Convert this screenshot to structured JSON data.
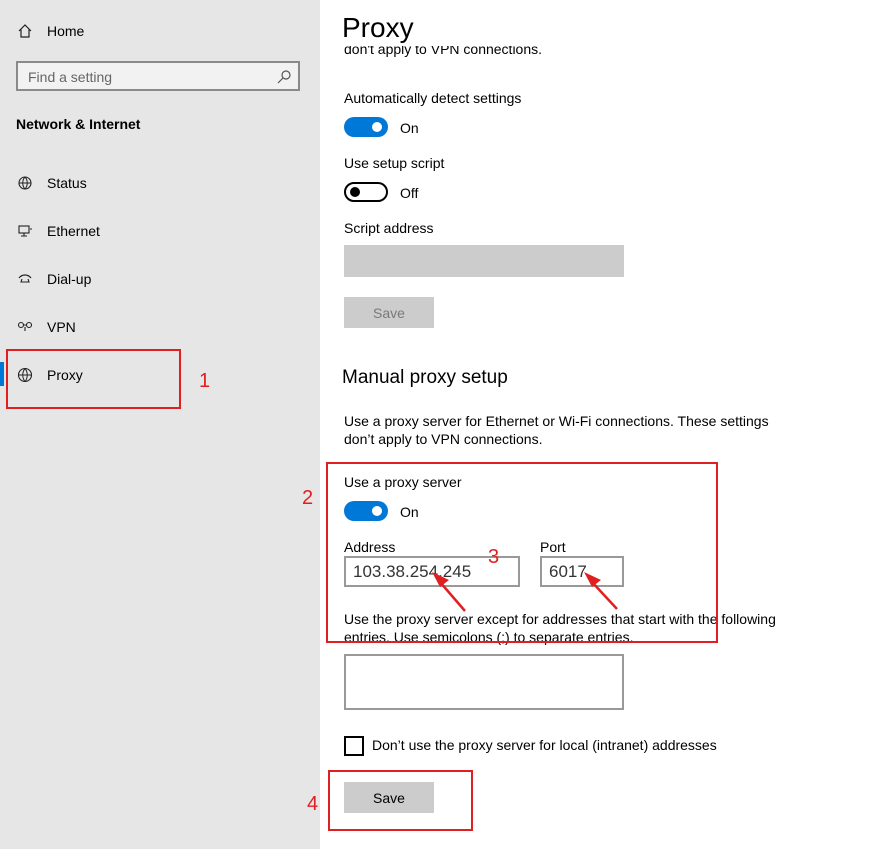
{
  "sidebar": {
    "home_label": "Home",
    "search_placeholder": "Find a setting",
    "section_title": "Network & Internet",
    "items": [
      {
        "label": "Status",
        "icon": "globe-status-icon"
      },
      {
        "label": "Ethernet",
        "icon": "ethernet-icon"
      },
      {
        "label": "Dial-up",
        "icon": "dial-up-icon"
      },
      {
        "label": "VPN",
        "icon": "vpn-icon"
      },
      {
        "label": "Proxy",
        "icon": "globe-icon"
      }
    ],
    "active_item": "Proxy"
  },
  "main": {
    "title": "Proxy",
    "clipped_text": "don't apply to VPN connections.",
    "auto_detect": {
      "label": "Automatically detect settings",
      "state": "On"
    },
    "setup_script": {
      "label": "Use setup script",
      "state": "Off"
    },
    "script_address": {
      "label": "Script address",
      "value": ""
    },
    "script_save": "Save",
    "manual_heading": "Manual proxy setup",
    "manual_desc_1": "Use a proxy server for Ethernet or Wi-Fi connections. These settings",
    "manual_desc_2": "don’t apply to VPN connections.",
    "use_proxy": {
      "label": "Use a proxy server",
      "state": "On"
    },
    "address": {
      "label": "Address",
      "value": "103.38.254.245"
    },
    "port": {
      "label": "Port",
      "value": "6017"
    },
    "exceptions_desc_1": "Use the proxy server except for addresses that start with the following",
    "exceptions_desc_2": "entries. Use semicolons (;) to separate entries.",
    "exceptions_value": "",
    "local_bypass": {
      "label": "Don’t use the proxy server for local (intranet) addresses",
      "checked": false
    },
    "save": "Save"
  },
  "annotations": {
    "labels": [
      "1",
      "2",
      "3",
      "4"
    ],
    "color": "#e02020"
  },
  "colors": {
    "accent": "#0078d7",
    "sidebar_bg": "#e6e6e6",
    "annotation": "#e02020"
  }
}
